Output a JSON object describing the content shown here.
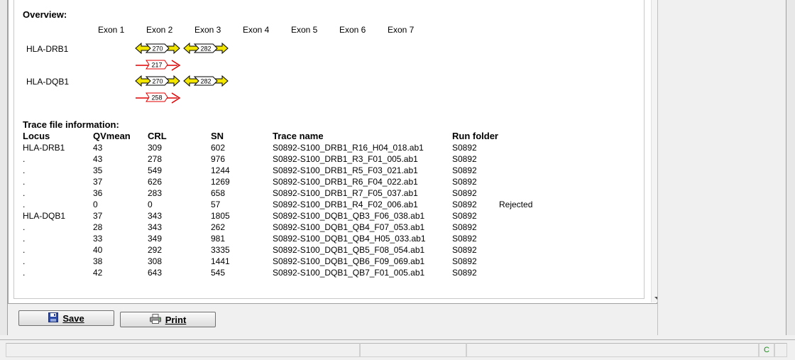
{
  "overview": {
    "title": "Overview:",
    "exons": [
      "Exon 1",
      "Exon 2",
      "Exon 3",
      "Exon 4",
      "Exon 5",
      "Exon 6",
      "Exon 7"
    ],
    "genes": [
      {
        "name": "HLA-DRB1",
        "forward": [
          {
            "exon": 2,
            "value": "270",
            "style": "yellow"
          },
          {
            "exon": 3,
            "value": "282",
            "style": "yellow"
          }
        ],
        "reverse": [
          {
            "exon": 2,
            "value": "217",
            "style": "red"
          }
        ]
      },
      {
        "name": "HLA-DQB1",
        "forward": [
          {
            "exon": 2,
            "value": "270",
            "style": "yellow"
          },
          {
            "exon": 3,
            "value": "282",
            "style": "yellow"
          }
        ],
        "reverse": [
          {
            "exon": 2,
            "value": "258",
            "style": "red"
          }
        ]
      }
    ]
  },
  "trace": {
    "title": "Trace file information:",
    "headers": [
      "Locus",
      "QVmean",
      "CRL",
      "SN",
      "Trace name",
      "Run folder"
    ],
    "rows": [
      {
        "locus": "HLA-DRB1",
        "qv": "43",
        "crl": "309",
        "sn": "602",
        "name": "S0892-S100_DRB1_R16_H04_018.ab1",
        "folder": "S0892",
        "note": ""
      },
      {
        "locus": ".",
        "qv": "43",
        "crl": "278",
        "sn": "976",
        "name": "S0892-S100_DRB1_R3_F01_005.ab1",
        "folder": "S0892",
        "note": ""
      },
      {
        "locus": ".",
        "qv": "35",
        "crl": "549",
        "sn": "1244",
        "name": "S0892-S100_DRB1_R5_F03_021.ab1",
        "folder": "S0892",
        "note": ""
      },
      {
        "locus": ".",
        "qv": "37",
        "crl": "626",
        "sn": "1269",
        "name": "S0892-S100_DRB1_R6_F04_022.ab1",
        "folder": "S0892",
        "note": ""
      },
      {
        "locus": ".",
        "qv": "36",
        "crl": "283",
        "sn": "658",
        "name": "S0892-S100_DRB1_R7_F05_037.ab1",
        "folder": "S0892",
        "note": ""
      },
      {
        "locus": ".",
        "qv": "0",
        "crl": "0",
        "sn": "57",
        "name": "S0892-S100_DRB1_R4_F02_006.ab1",
        "folder": "S0892",
        "note": "Rejected"
      },
      {
        "locus": "HLA-DQB1",
        "qv": "37",
        "crl": "343",
        "sn": "1805",
        "name": "S0892-S100_DQB1_QB3_F06_038.ab1",
        "folder": "S0892",
        "note": ""
      },
      {
        "locus": ".",
        "qv": "28",
        "crl": "343",
        "sn": "262",
        "name": "S0892-S100_DQB1_QB4_F07_053.ab1",
        "folder": "S0892",
        "note": ""
      },
      {
        "locus": ".",
        "qv": "33",
        "crl": "349",
        "sn": "981",
        "name": "S0892-S100_DQB1_QB4_H05_033.ab1",
        "folder": "S0892",
        "note": ""
      },
      {
        "locus": ".",
        "qv": "40",
        "crl": "292",
        "sn": "3335",
        "name": "S0892-S100_DQB1_QB5_F08_054.ab1",
        "folder": "S0892",
        "note": ""
      },
      {
        "locus": ".",
        "qv": "38",
        "crl": "308",
        "sn": "1441",
        "name": "S0892-S100_DQB1_QB6_F09_069.ab1",
        "folder": "S0892",
        "note": ""
      },
      {
        "locus": ".",
        "qv": "42",
        "crl": "643",
        "sn": "545",
        "name": "S0892-S100_DQB1_QB7_F01_005.ab1",
        "folder": "S0892",
        "note": ""
      }
    ]
  },
  "buttons": {
    "save": "Save",
    "print": "Print"
  },
  "status": {
    "indicator": "C"
  },
  "colors": {
    "yellow": "#f2e600",
    "red": "#e00000",
    "status_green": "#1a8c1a"
  }
}
